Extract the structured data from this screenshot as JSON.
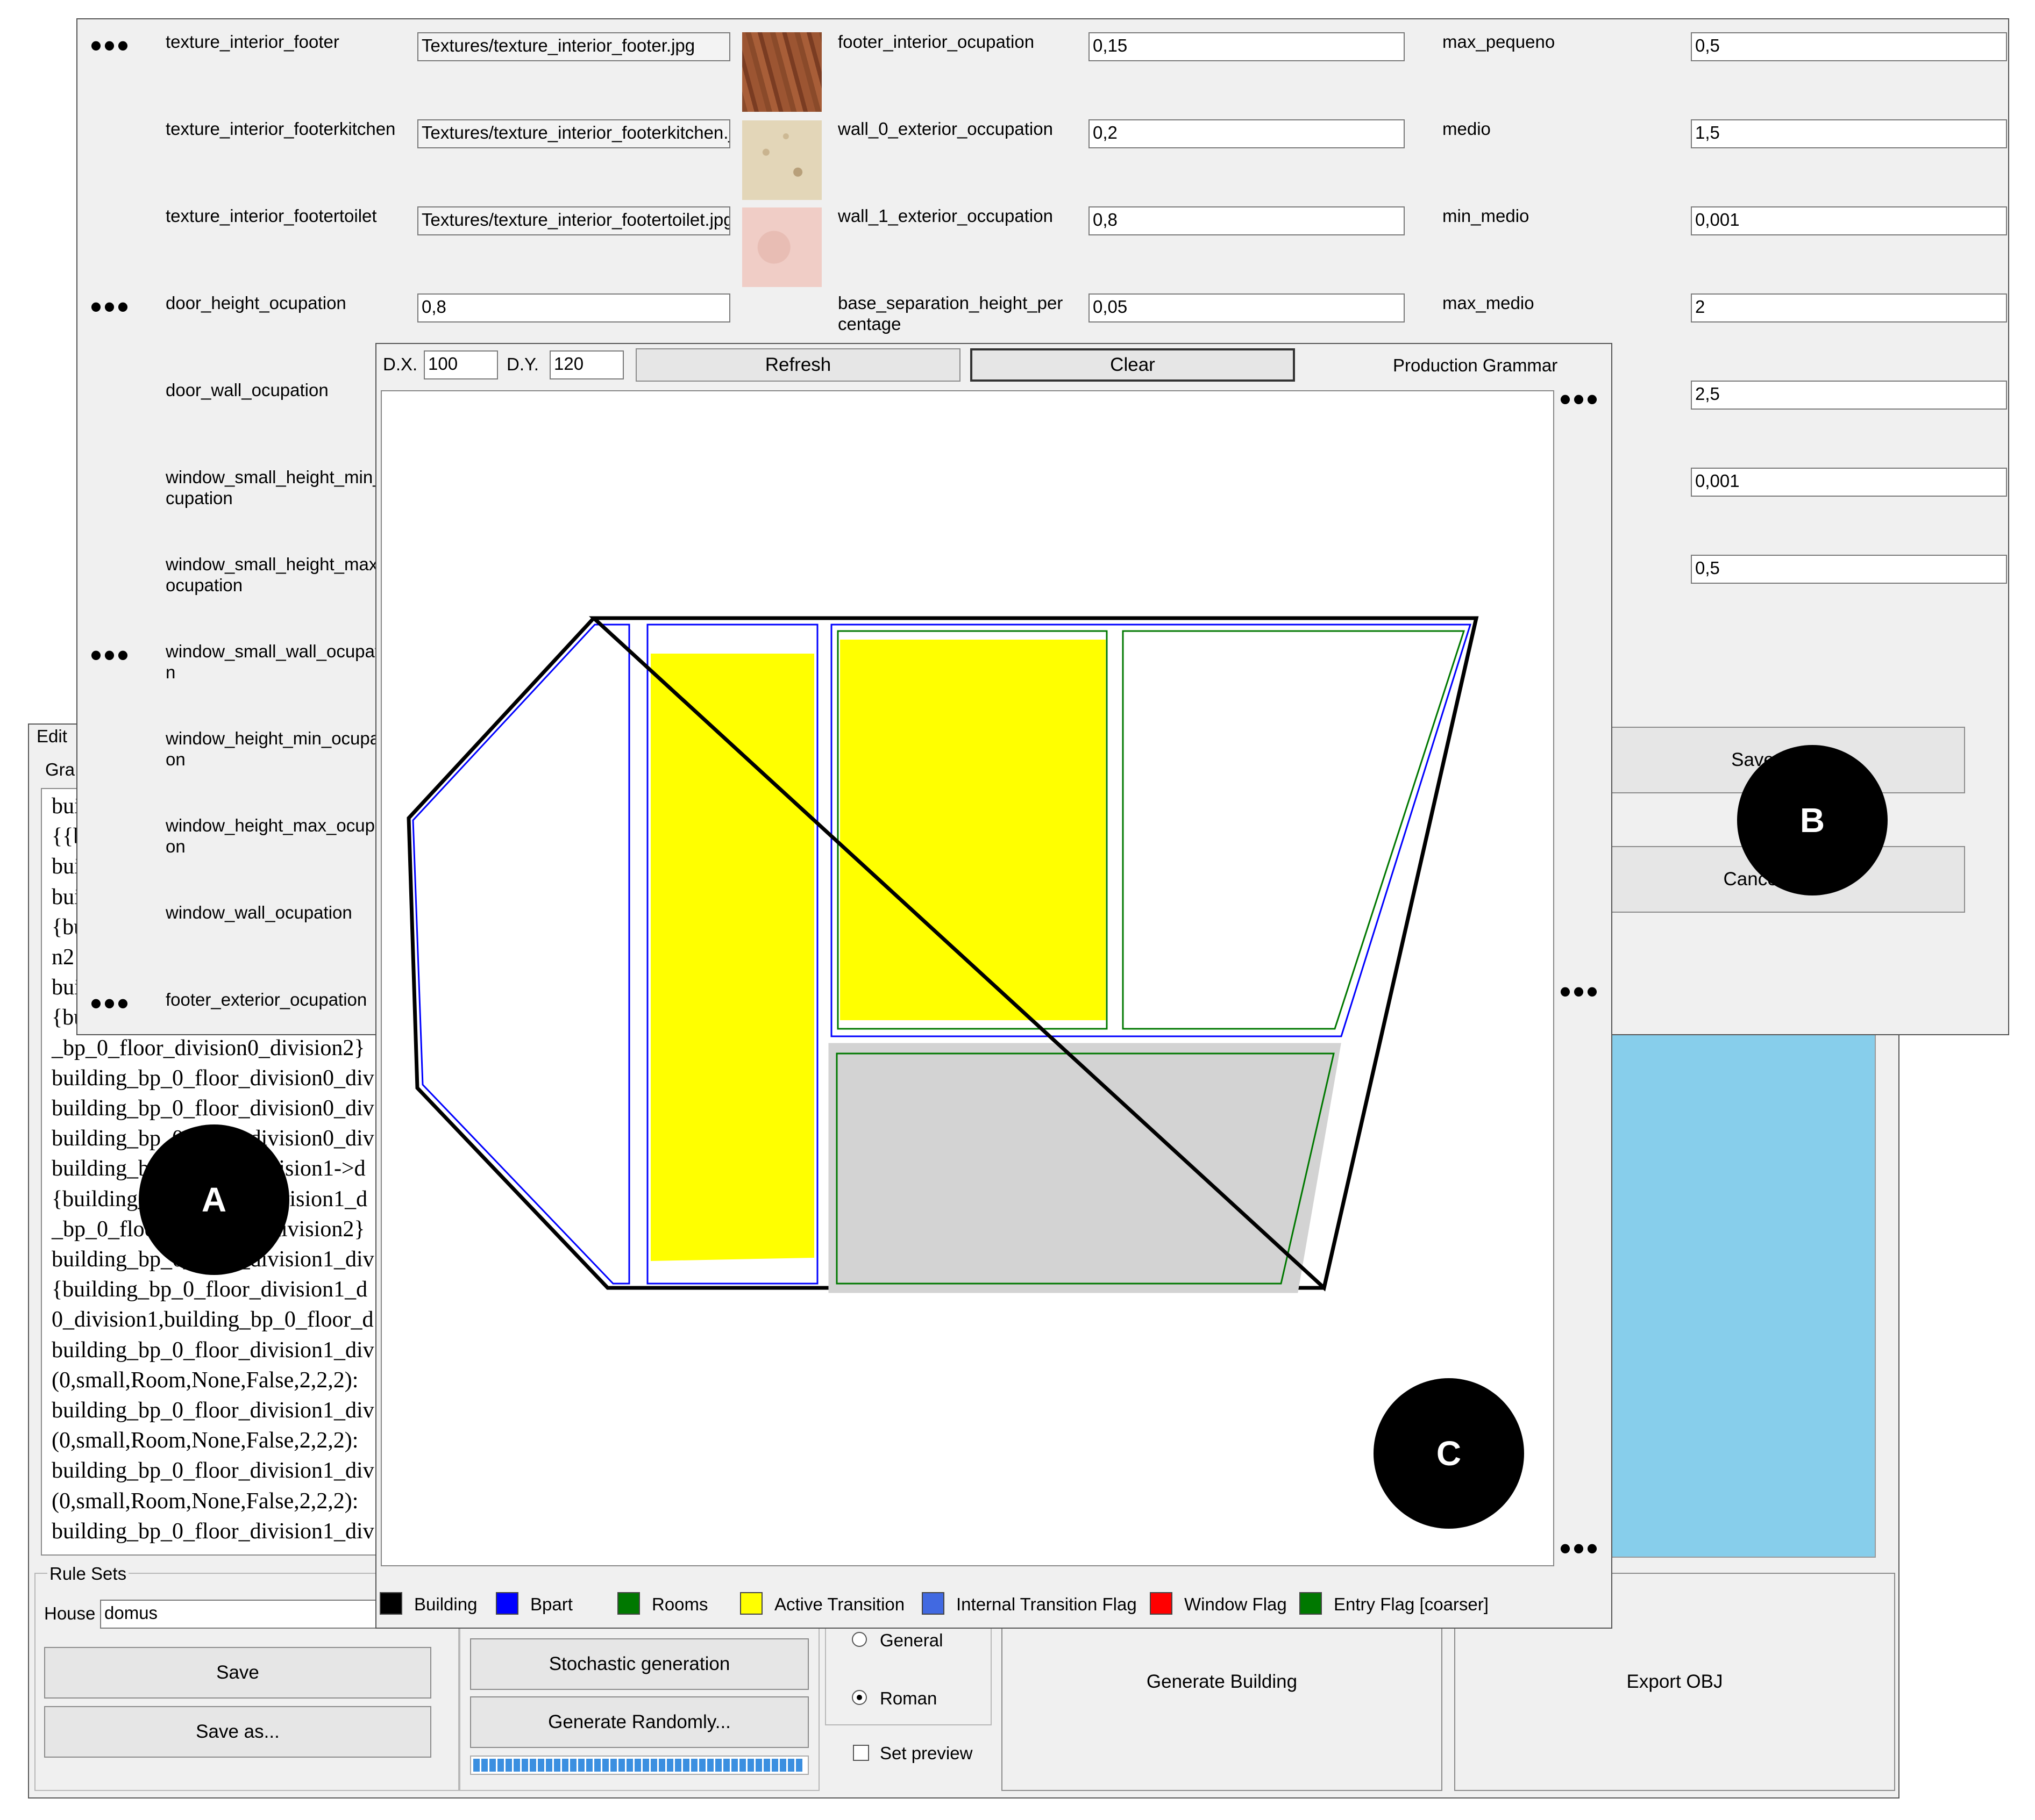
{
  "callouts": {
    "a": "A",
    "b": "B",
    "c": "C"
  },
  "main_window": {
    "menu_edit": "Edit",
    "grammar_group_label": "Gra",
    "grammar_lines": [
      "bui",
      "{{b",
      "bui",
      "bui",
      "{bu",
      "n2",
      "bui",
      "{bu",
      "_bp_0_floor_division0_division2}",
      "building_bp_0_floor_division0_div",
      "building_bp_0_floor_division0_div",
      "building_bp_0_floor_division0_div",
      "building_bp_0_floor_division1->d",
      "{building_bp_0_floor_division1_d",
      "_bp_0_floor_division1_division2}",
      "building_bp_0_floor_division1_div",
      "{building_bp_0_floor_division1_d",
      "0_division1,building_bp_0_floor_d",
      "building_bp_0_floor_division1_div",
      "(0,small,Room,None,False,2,2,2):",
      "building_bp_0_floor_division1_div",
      "(0,small,Room,None,False,2,2,2):",
      "building_bp_0_floor_division1_div",
      "(0,small,Room,None,False,2,2,2):",
      "building_bp_0_floor_division1_div"
    ],
    "rule_sets_label": "Rule Sets",
    "house_label": "House",
    "house_value": "domus",
    "save_label": "Save",
    "save_as_label": "Save as...",
    "stochastic_label": "Stochastic generation",
    "generate_randomly_label": "Generate Randomly...",
    "radio_general": "General",
    "radio_roman": "Roman",
    "set_preview": "Set preview",
    "generate_building": "Generate Building",
    "export_obj": "Export OBJ",
    "progress": 1.0
  },
  "params_window": {
    "col1": [
      {
        "dots": true,
        "name": "texture_interior_footer",
        "value": "Textures/texture_interior_footer.jpg",
        "readonly": true
      },
      {
        "dots": false,
        "name": "texture_interior_footerkitchen",
        "value": "Textures/texture_interior_footerkitchen.jp",
        "readonly": true
      },
      {
        "dots": false,
        "name": "texture_interior_footertoilet",
        "value": "Textures/texture_interior_footertoilet.jpg",
        "readonly": true
      },
      {
        "dots": true,
        "name": "door_height_ocupation",
        "value": "0,8",
        "readonly": false
      },
      {
        "dots": false,
        "name": "door_wall_ocupation",
        "value": "",
        "readonly": false
      },
      {
        "dots": false,
        "name": "window_small_height_min_ocupation",
        "value": "",
        "readonly": false
      },
      {
        "dots": false,
        "name": "window_small_height_max_ocupation",
        "value": "",
        "readonly": false
      },
      {
        "dots": true,
        "name": "window_small_wall_ocupation",
        "value": "",
        "readonly": false
      },
      {
        "dots": false,
        "name": "window_height_min_ocupation",
        "value": "",
        "readonly": false
      },
      {
        "dots": false,
        "name": "window_height_max_ocupation",
        "value": "",
        "readonly": false
      },
      {
        "dots": false,
        "name": "window_wall_ocupation",
        "value": "",
        "readonly": false
      },
      {
        "dots": true,
        "name": "footer_exterior_ocupation",
        "value": "",
        "readonly": false
      }
    ],
    "col2": [
      {
        "name": "footer_interior_ocupation",
        "value": "0,15"
      },
      {
        "name": "wall_0_exterior_occupation",
        "value": "0,2"
      },
      {
        "name": "wall_1_exterior_occupation",
        "value": "0,8"
      },
      {
        "name": "base_separation_height_percentage",
        "value": "0,05"
      }
    ],
    "col3": [
      {
        "name": "max_pequeno",
        "value": "0,5"
      },
      {
        "name": "medio",
        "value": "1,5"
      },
      {
        "name": "min_medio",
        "value": "0,001"
      },
      {
        "name": "max_medio",
        "value": "2"
      },
      {
        "name": "",
        "value": "2,5"
      },
      {
        "name": "",
        "value": "0,001"
      },
      {
        "name": "",
        "value": "0,5"
      }
    ],
    "save_label": "Save",
    "cancel_label": "Cancel"
  },
  "preview_window": {
    "dx_label": "D.X.",
    "dx_value": "100",
    "dy_label": "D.Y.",
    "dy_value": "120",
    "refresh_label": "Refresh",
    "clear_label": "Clear",
    "title": "Production Grammar",
    "legend": [
      {
        "label": "Building",
        "color": "#000000"
      },
      {
        "label": "Bpart",
        "color": "#0000ff"
      },
      {
        "label": "Rooms",
        "color": "#007800"
      },
      {
        "label": "Active Transition",
        "color": "#ffff00"
      },
      {
        "label": "Internal Transition Flag",
        "color": "#4169e1"
      },
      {
        "label": "Window Flag",
        "color": "#ff0000"
      },
      {
        "label": "Entry Flag [coarser]",
        "color": "#007800"
      }
    ]
  },
  "colors": {
    "sky": "#87ceeb",
    "active": "#ffff00",
    "gray_room": "#d3d3d3"
  },
  "icons": [
    "wood-texture-thumbnail",
    "stone-texture-thumbnail",
    "pink-texture-thumbnail",
    "radio-selected-icon",
    "checkbox-icon"
  ]
}
